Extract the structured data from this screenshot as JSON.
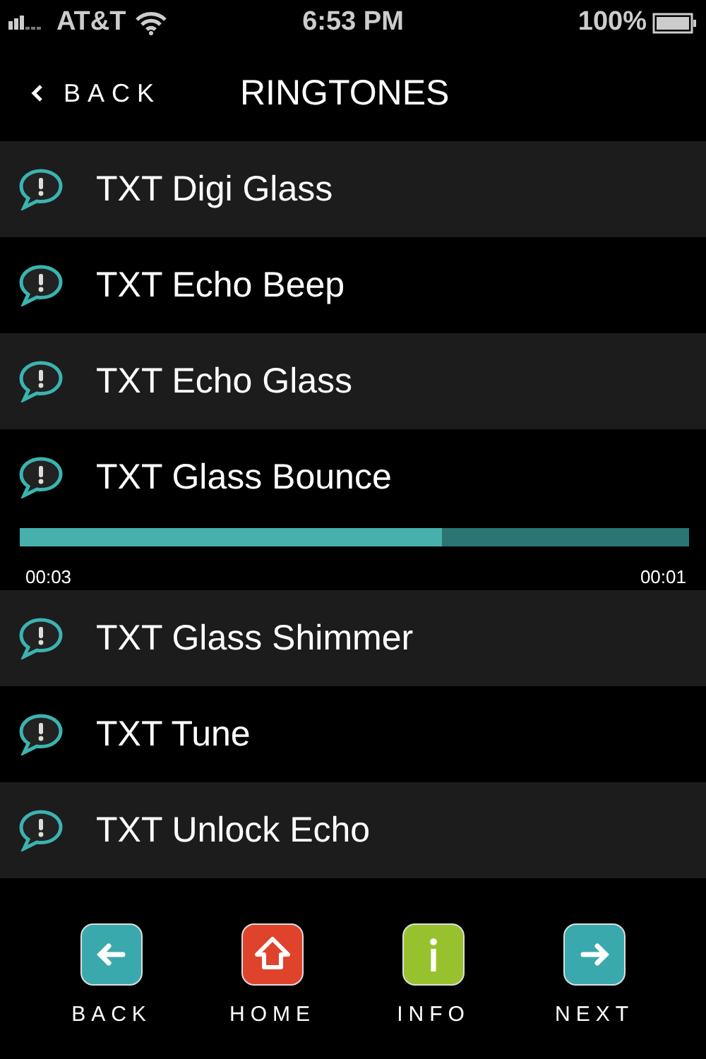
{
  "status_bar": {
    "carrier": "AT&T",
    "time": "6:53 PM",
    "battery": "100%"
  },
  "nav": {
    "back": "BACK",
    "title": "RINGTONES"
  },
  "ringtones": [
    {
      "name": "TXT Digi Glass"
    },
    {
      "name": "TXT Echo Beep"
    },
    {
      "name": "TXT Echo Glass"
    },
    {
      "name": "TXT Glass Bounce",
      "progress": {
        "level": 0.63,
        "elapsed": "00:03",
        "remaining": "00:01"
      }
    },
    {
      "name": "TXT Glass Shimmer"
    },
    {
      "name": "TXT Tune"
    },
    {
      "name": "TXT Unlock Echo"
    }
  ],
  "toolbar": [
    {
      "kind": "back",
      "label": "BACK",
      "color": "#3aa9ad"
    },
    {
      "kind": "home",
      "label": "HOME",
      "color": "#e0432c"
    },
    {
      "kind": "info",
      "label": "INFO",
      "color": "#98c22d"
    },
    {
      "kind": "next",
      "label": "NEXT",
      "color": "#3aa9ad"
    }
  ]
}
